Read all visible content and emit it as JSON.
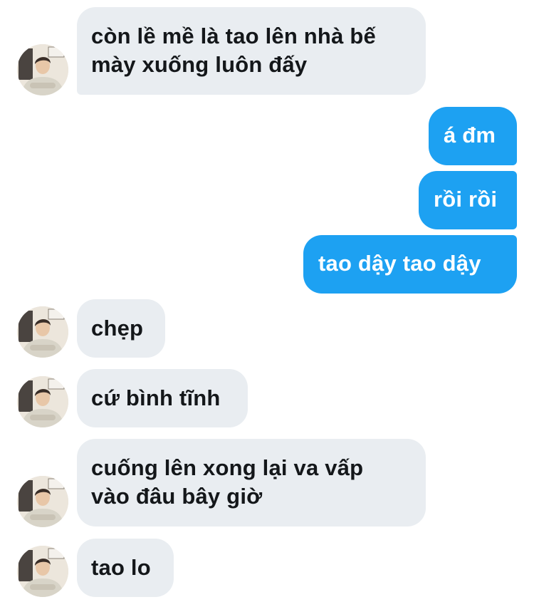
{
  "conversation": {
    "messages": [
      {
        "direction": "in",
        "text": "còn lề mề là tao lên nhà bế\nmày xuống luôn đấy"
      },
      {
        "direction": "out",
        "text": "á đm"
      },
      {
        "direction": "out",
        "text": "rồi rồi"
      },
      {
        "direction": "out",
        "text": "tao dậy tao dậy"
      },
      {
        "direction": "in",
        "text": "chẹp"
      },
      {
        "direction": "in",
        "text": "cứ bình tĩnh"
      },
      {
        "direction": "in",
        "text": "cuống lên xong lại va vấp\nvào đâu bây giờ"
      },
      {
        "direction": "in",
        "text": "tao lo"
      }
    ]
  },
  "colors": {
    "incoming_bubble": "#e9edf1",
    "incoming_text": "#14171a",
    "outgoing_bubble": "#1da1f2",
    "outgoing_text": "#ffffff"
  },
  "icons": {
    "avatar": "contact-avatar-photo"
  }
}
